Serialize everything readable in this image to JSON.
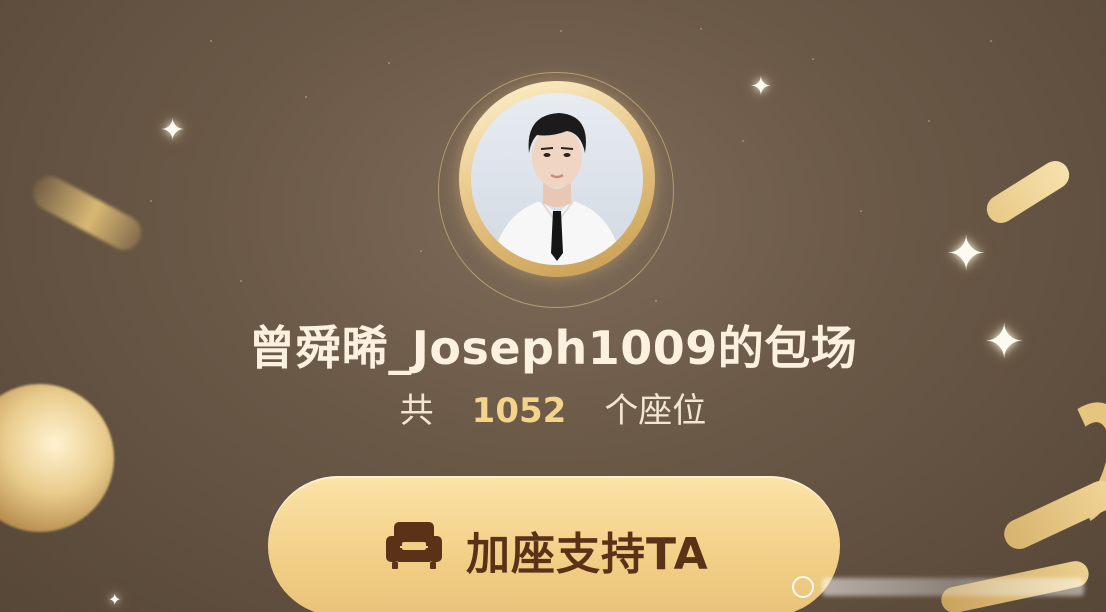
{
  "title": "曾舜晞_Joseph1009的包场",
  "seat_info": {
    "prefix": "共",
    "count": "1052",
    "suffix": "个座位"
  },
  "cta": {
    "label": "加座支持TA",
    "icon": "sofa-icon"
  },
  "avatar": {
    "icon": "user-avatar"
  },
  "colors": {
    "background": "#6a5847",
    "title_text": "#fbf1de",
    "count_text": "#f3d48a",
    "button_bg": "#f2cf86",
    "button_text": "#5a3218"
  }
}
